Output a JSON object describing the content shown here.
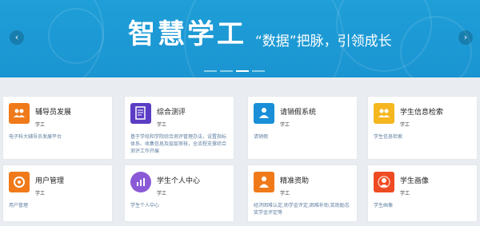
{
  "banner": {
    "title": "智慧学工",
    "slogan": "“数据”把脉，引领成长",
    "prev_label": "‹",
    "next_label": "›"
  },
  "cards": [
    {
      "title": "辅导员发展",
      "category": "学工",
      "desc": "电子科大辅导员发展平台",
      "icon": "people-icon",
      "color": "#f07a1a"
    },
    {
      "title": "综合测评",
      "category": "学工",
      "desc": "基于学校和学院综合测评管理办法，设置指标体系、收集信息及层层审核，全流程支撑综合测评工作开展",
      "icon": "document-icon",
      "color": "#5b3cc4"
    },
    {
      "title": "请销假系统",
      "category": "学工",
      "desc": "请销假",
      "icon": "leave-icon",
      "color": "#1a8fd8"
    },
    {
      "title": "学生信息检索",
      "category": "学工",
      "desc": "学生信息检索",
      "icon": "people-search-icon",
      "color": "#f5b71f"
    },
    {
      "title": "用户管理",
      "category": "学工",
      "desc": "用户管理",
      "icon": "user-manage-icon",
      "color": "#f07a1a"
    },
    {
      "title": "学生个人中心",
      "category": "学工",
      "desc": "学生个人中心",
      "icon": "chart-icon",
      "color": "#8a5ad6"
    },
    {
      "title": "精准资助",
      "category": "学工",
      "desc": "经济困难认定,助学金评定,困难补助,奖助励志奖学金评定等",
      "icon": "person-icon",
      "color": "#f07a1a"
    },
    {
      "title": "学生画像",
      "category": "学工",
      "desc": "学生画像",
      "icon": "profile-icon",
      "color": "#ef4b22"
    }
  ]
}
